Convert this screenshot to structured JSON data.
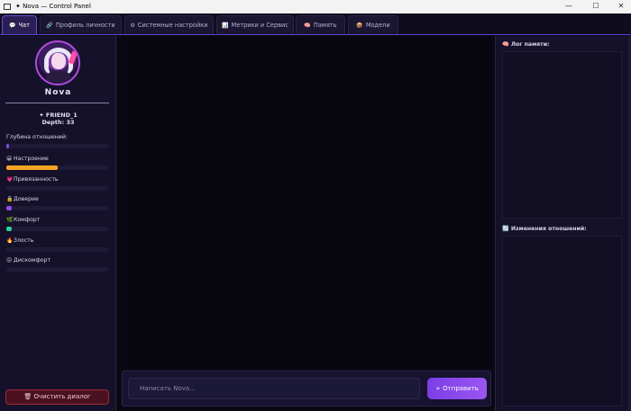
{
  "window": {
    "title": "✦ Nova — Control Panel",
    "minimize": "—",
    "maximize": "☐",
    "close": "✕"
  },
  "tabs": [
    {
      "icon": "💬",
      "label": "Чат",
      "active": true
    },
    {
      "icon": "🔗",
      "label": "Профиль личности"
    },
    {
      "icon": "⚙",
      "label": "Системные настройки"
    },
    {
      "icon": "📊",
      "label": "Метрики и Сервис"
    },
    {
      "icon": "🧠",
      "label": "Память"
    },
    {
      "icon": "📦",
      "label": "Модели"
    }
  ],
  "profile": {
    "name": "Nova",
    "status": "✦ FRIEND_1",
    "depth": "Depth: 33"
  },
  "metrics": [
    {
      "icon": "",
      "label": "Глубина отношений:",
      "fill": 0.03,
      "color": "#7b4be8"
    },
    {
      "icon": "😀",
      "label": "Настроение",
      "fill": 0.5,
      "color": "#f5a524"
    },
    {
      "icon": "💗",
      "label": "Привязанность",
      "fill": 0.0,
      "color": "#e0569a"
    },
    {
      "icon": "🔒",
      "label": "Доверие",
      "fill": 0.05,
      "color": "#8a4be8"
    },
    {
      "icon": "🌿",
      "label": "Комфорт",
      "fill": 0.05,
      "color": "#2bd09a"
    },
    {
      "icon": "🔥",
      "label": "Злость",
      "fill": 0.0,
      "color": "#e05656"
    },
    {
      "icon": "😖",
      "label": "Дискомфорт",
      "fill": 0.0,
      "color": "#d08a2b"
    }
  ],
  "actions": {
    "clear_icon": "🗑",
    "clear_label": "Очистить диалог"
  },
  "chat": {
    "placeholder": "Написать Nova...",
    "send_label": "➢ Отправить"
  },
  "memory": {
    "log_title": "🧠 Лог памяти:",
    "changes_title": "🔄 Изменения отношений:"
  }
}
